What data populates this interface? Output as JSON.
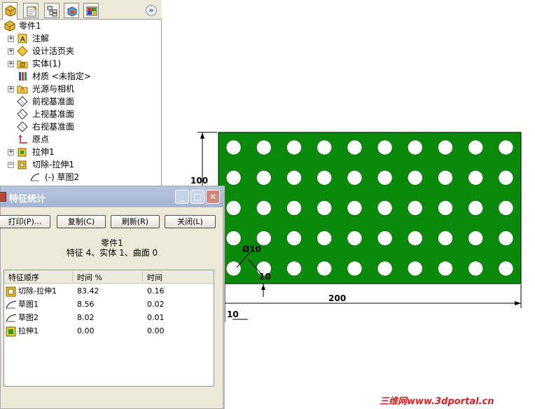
{
  "feature_tree": {
    "root_label": "零件1",
    "items": [
      {
        "label": "注解",
        "icon": "annotation-icon",
        "expandable": true
      },
      {
        "label": "设计活页夹",
        "icon": "design-binder-icon",
        "expandable": true
      },
      {
        "label": "实体(1)",
        "icon": "solid-body-folder-icon",
        "expandable": true
      },
      {
        "label": "材质 <未指定>",
        "icon": "material-icon",
        "expandable": false
      },
      {
        "label": "光源与相机",
        "icon": "lights-camera-icon",
        "expandable": true
      },
      {
        "label": "前视基准面",
        "icon": "plane-icon",
        "expandable": false
      },
      {
        "label": "上视基准面",
        "icon": "plane-icon",
        "expandable": false
      },
      {
        "label": "右视基准面",
        "icon": "plane-icon",
        "expandable": false
      },
      {
        "label": "原点",
        "icon": "origin-icon",
        "expandable": false
      },
      {
        "label": "拉伸1",
        "icon": "extrude-icon",
        "expandable": true
      },
      {
        "label": "切除-拉伸1",
        "icon": "cut-extrude-icon",
        "expandable": true,
        "expanded": true
      },
      {
        "label": "(-) 草图2",
        "icon": "sketch-icon",
        "expandable": false,
        "child": true
      }
    ],
    "tabs": [
      "feature-manager-tab",
      "property-manager-tab",
      "configuration-manager-tab",
      "dim-xpert-tab",
      "display-manager-tab"
    ],
    "expand_glyph": "»"
  },
  "dialog": {
    "title": "特征统计",
    "buttons": {
      "print": "打印(P)...",
      "copy": "复制(C)",
      "refresh": "刷新(R)",
      "close": "关闭(L)"
    },
    "part_name": "零件1",
    "stats_line": "特征 4、实体 1、曲面 0",
    "columns": [
      "特征顺序",
      "时间 %",
      "时间"
    ],
    "rows": [
      {
        "name": "切除-拉伸1",
        "percent": "83.42",
        "time": "0.16",
        "icon": "cut-extrude-icon"
      },
      {
        "name": "草图1",
        "percent": "8.56",
        "time": "0.02",
        "icon": "sketch-icon"
      },
      {
        "name": "草图2",
        "percent": "8.02",
        "time": "0.01",
        "icon": "sketch-icon"
      },
      {
        "name": "拉伸1",
        "percent": "0.00",
        "time": "0.00",
        "icon": "extrude-icon"
      }
    ]
  },
  "drawing": {
    "plate_color": "#0a8a0a",
    "hole_rows": 5,
    "hole_cols": 10,
    "dimensions": {
      "height": "100",
      "width": "200",
      "diameter": "Ø10",
      "pitch": "10",
      "offset": "10"
    }
  },
  "watermark": "三维网www.3dportal.cn"
}
